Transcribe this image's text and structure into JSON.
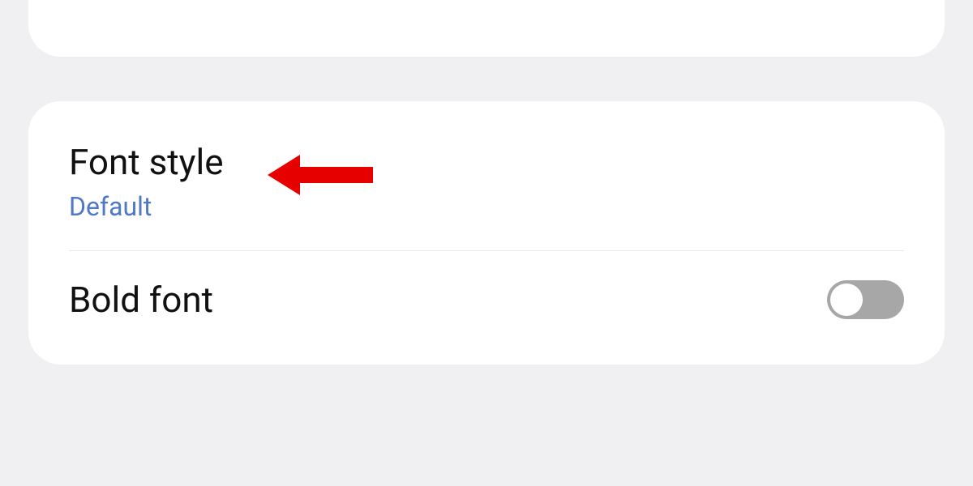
{
  "settings": {
    "font_style": {
      "title": "Font style",
      "value": "Default"
    },
    "bold_font": {
      "title": "Bold font",
      "enabled": false
    }
  },
  "annotation": {
    "type": "arrow-left",
    "color": "#e60000"
  }
}
